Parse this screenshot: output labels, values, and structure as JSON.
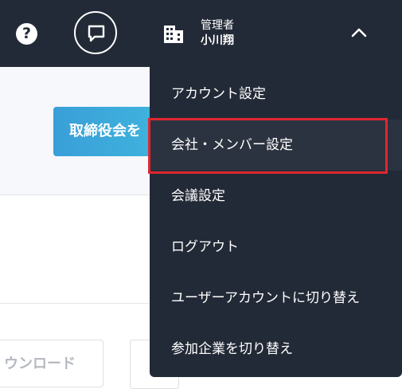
{
  "header": {
    "user_role": "管理者",
    "user_name": "小川翔",
    "help_glyph": "?"
  },
  "content": {
    "primary_button_label": "取締役会を",
    "download_button_label": "ウンロード"
  },
  "menu": {
    "items": [
      {
        "label": "アカウント設定"
      },
      {
        "label": "会社・メンバー設定"
      },
      {
        "label": "会議設定"
      },
      {
        "label": "ログアウト"
      },
      {
        "label": "ユーザーアカウントに切り替え"
      },
      {
        "label": "参加企業を切り替え"
      }
    ]
  },
  "colors": {
    "header_bg": "#232a37",
    "highlight": "#e0262f",
    "primary_button": "#3a9fd8"
  },
  "icons": [
    "help-icon",
    "chat-icon",
    "building-icon",
    "chevron-up-icon"
  ]
}
